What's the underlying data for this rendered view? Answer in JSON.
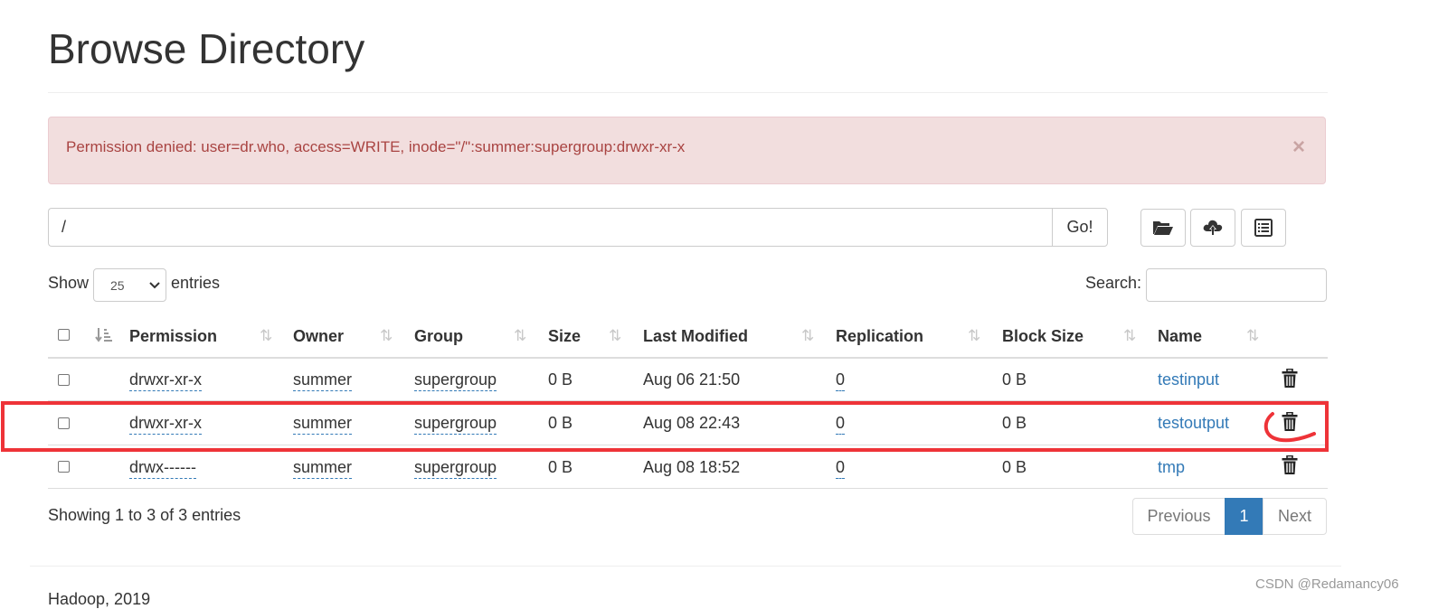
{
  "page": {
    "title": "Browse Directory"
  },
  "alert": {
    "message": "Permission denied: user=dr.who, access=WRITE, inode=\"/\":summer:supergroup:drwxr-xr-x",
    "close_label": "×"
  },
  "path_bar": {
    "value": "/",
    "go_label": "Go!"
  },
  "toolbar": {
    "icons": [
      "folder-open-icon",
      "cloud-upload-icon",
      "list-alt-icon"
    ]
  },
  "table_controls": {
    "show_label": "Show",
    "entries_value": "25",
    "entries_label": "entries",
    "search_label": "Search:",
    "search_value": ""
  },
  "table": {
    "columns": [
      "Permission",
      "Owner",
      "Group",
      "Size",
      "Last Modified",
      "Replication",
      "Block Size",
      "Name"
    ],
    "rows": [
      {
        "permission": "drwxr-xr-x",
        "owner": "summer",
        "group": "supergroup",
        "size": "0 B",
        "last_modified": "Aug 06 21:50",
        "replication": "0",
        "block_size": "0 B",
        "name": "testinput"
      },
      {
        "permission": "drwxr-xr-x",
        "owner": "summer",
        "group": "supergroup",
        "size": "0 B",
        "last_modified": "Aug 08 22:43",
        "replication": "0",
        "block_size": "0 B",
        "name": "testoutput"
      },
      {
        "permission": "drwx------",
        "owner": "summer",
        "group": "supergroup",
        "size": "0 B",
        "last_modified": "Aug 08 18:52",
        "replication": "0",
        "block_size": "0 B",
        "name": "tmp"
      }
    ]
  },
  "pagination": {
    "summary": "Showing 1 to 3 of 3 entries",
    "previous_label": "Previous",
    "current_page": "1",
    "next_label": "Next"
  },
  "footer": {
    "text": "Hadoop, 2019"
  },
  "watermark": {
    "text": "CSDN @Redamancy06"
  },
  "colors": {
    "link": "#337ab7",
    "alert_bg": "#f2dede",
    "alert_text": "#a94442",
    "highlight": "#ee3338",
    "active_page": "#337ab7"
  }
}
